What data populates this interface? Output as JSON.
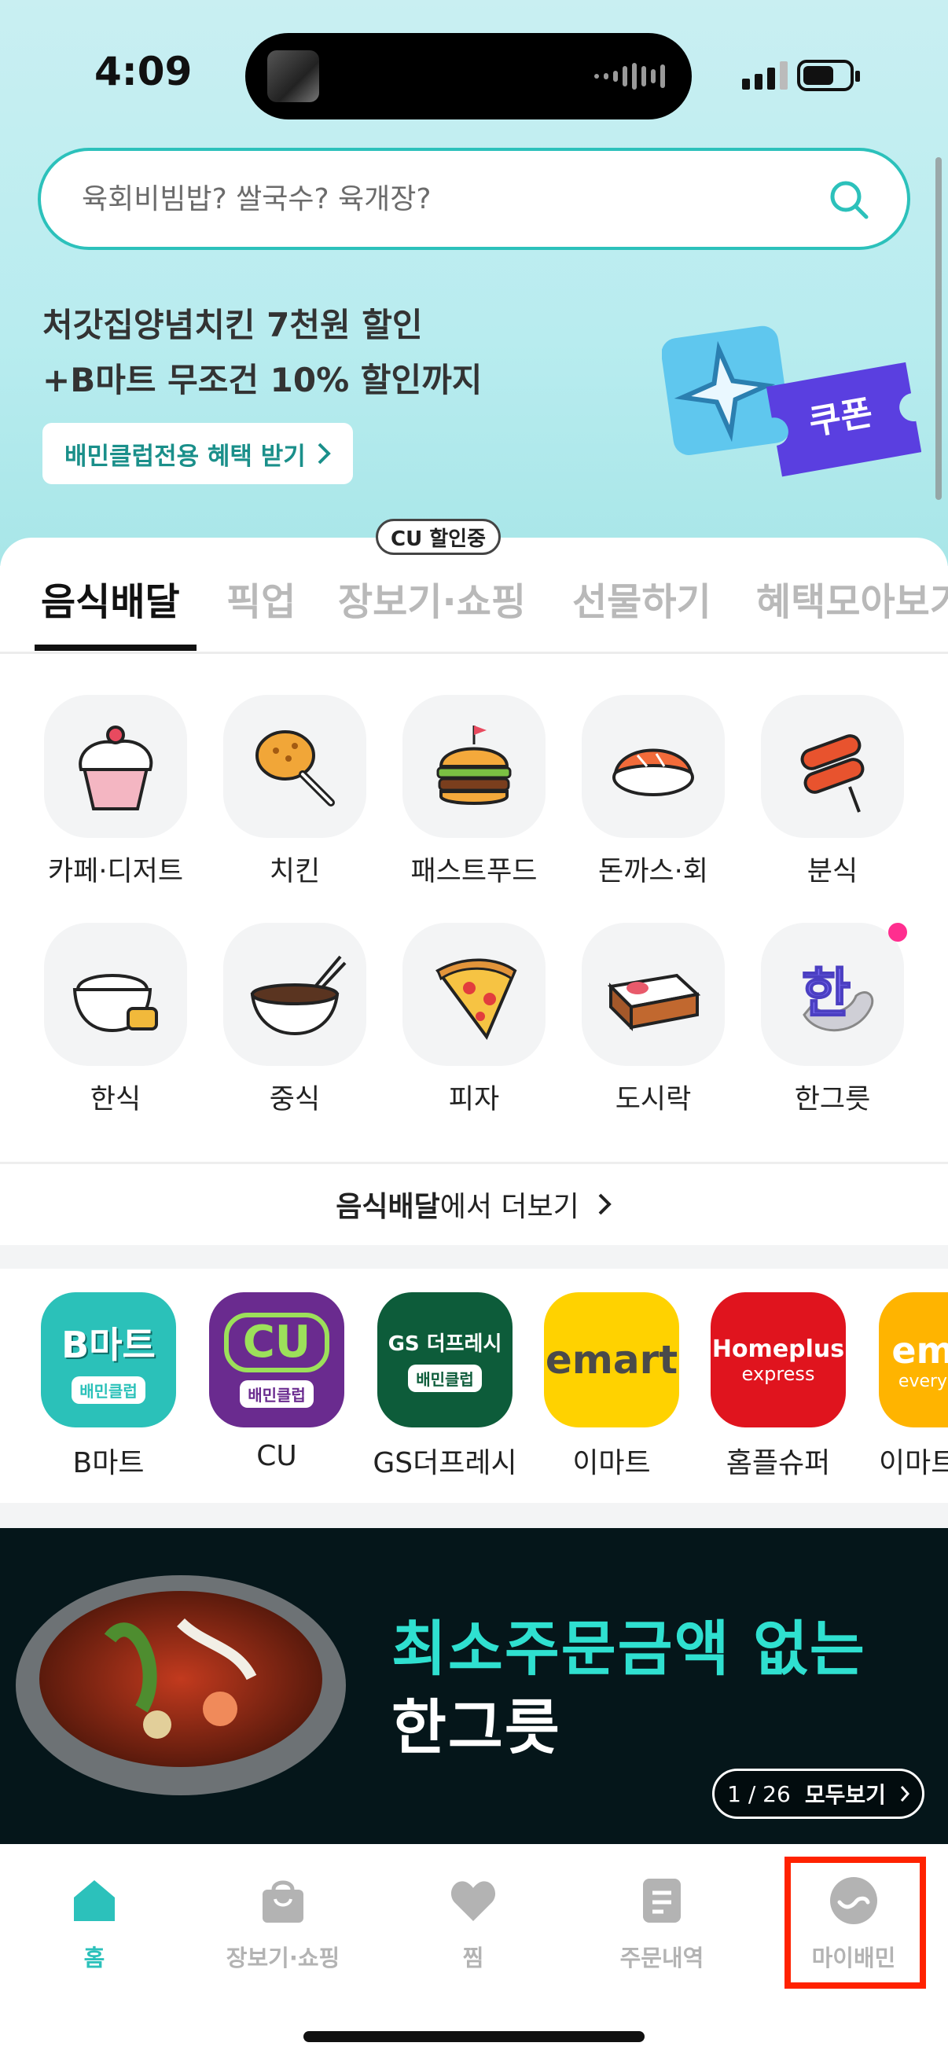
{
  "status_bar": {
    "time": "4:09"
  },
  "search": {
    "placeholder": "육회비빔밥? 쌀국수? 육개장?"
  },
  "promo": {
    "line1": "처갓집양념치킨 7천원 할인",
    "line2": "+B마트 무조건 10% 할인까지",
    "button_label": "배민클럽전용 혜택 받기",
    "coupon_text": "쿠폰"
  },
  "tabs": {
    "badge": "CU 할인중",
    "items": [
      "음식배달",
      "픽업",
      "장보기·쇼핑",
      "선물하기",
      "혜택모아보기"
    ],
    "active": "음식배달"
  },
  "categories": [
    {
      "label": "카페·디저트",
      "icon": "cupcake-icon"
    },
    {
      "label": "치킨",
      "icon": "chicken-icon"
    },
    {
      "label": "패스트푸드",
      "icon": "burger-icon"
    },
    {
      "label": "돈까스·회",
      "icon": "sushi-icon"
    },
    {
      "label": "분식",
      "icon": "tteokbokki-icon"
    },
    {
      "label": "한식",
      "icon": "rice-bowl-icon"
    },
    {
      "label": "중식",
      "icon": "noodle-icon"
    },
    {
      "label": "피자",
      "icon": "pizza-icon"
    },
    {
      "label": "도시락",
      "icon": "lunchbox-icon"
    },
    {
      "label": "한그릇",
      "icon": "hangureut-icon",
      "glyph": "한"
    }
  ],
  "more_link": {
    "bold": "음식배달",
    "rest": "에서 더보기"
  },
  "stores": [
    {
      "label": "B마트",
      "logo_text": "B마트",
      "sub": "배민클럽",
      "bg": "#2bc1b9"
    },
    {
      "label": "CU",
      "logo_text": "CU",
      "sub": "배민클럽",
      "bg": "#6a2b8f"
    },
    {
      "label": "GS더프레시",
      "logo_text": "GS 더프레시",
      "sub": "배민클럽",
      "bg": "#0d5c3a"
    },
    {
      "label": "이마트",
      "logo_text": "emart",
      "bg": "#ffd200"
    },
    {
      "label": "홈플슈퍼",
      "logo_text": "Homeplus",
      "logo_sub": "express",
      "bg": "#e0141e"
    },
    {
      "label": "이마트",
      "logo_text": "em",
      "logo_sub": "every",
      "bg": "#ffb400"
    }
  ],
  "banner": {
    "line1": "최소주문금액 없는",
    "line2": "한그릇",
    "pager": "1 / 26",
    "view_all": "모두보기"
  },
  "bottom_nav": [
    {
      "label": "홈",
      "icon": "home-icon",
      "active": true
    },
    {
      "label": "장보기·쇼핑",
      "icon": "shopping-bag-icon"
    },
    {
      "label": "찜",
      "icon": "heart-icon"
    },
    {
      "label": "주문내역",
      "icon": "order-list-icon"
    },
    {
      "label": "마이배민",
      "icon": "my-baemin-icon"
    }
  ],
  "colors": {
    "accent": "#2cc1bb",
    "highlight": "#ff2200",
    "notification_dot": "#ff2e8f"
  }
}
